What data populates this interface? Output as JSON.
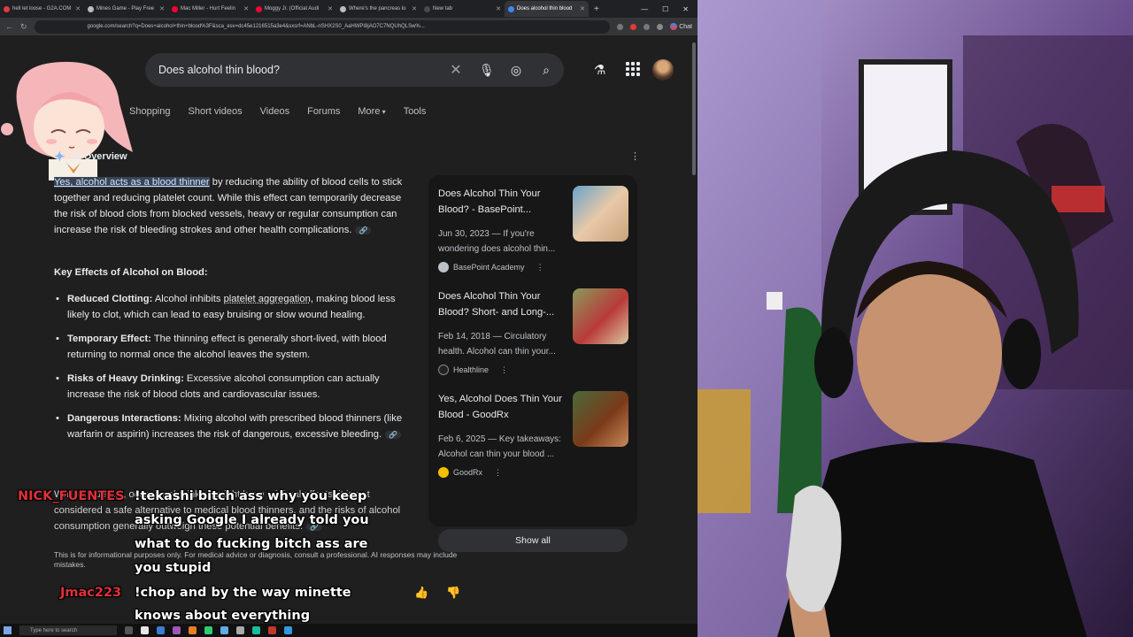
{
  "tabs": [
    {
      "label": "hell let loose - G2A.COM",
      "color": "#e03b3b"
    },
    {
      "label": "Mines Game - Play Free",
      "color": "#bbbbbb"
    },
    {
      "label": "Mac Miller - Hurt Feelin",
      "color": "#ff0033"
    },
    {
      "label": "Moggy Jr. (Official Audi",
      "color": "#ff0033"
    },
    {
      "label": "Where's the pancreas lo",
      "color": "#bbbbbb"
    },
    {
      "label": "New tab",
      "color": "#4a4a4a"
    },
    {
      "label": "Does alcohol thin blood",
      "color": "#4285f4",
      "active": true
    }
  ],
  "browser": {
    "url": "google.com/search?q=Does+alcohol+thin+blood%3F&sca_esv=dc45e1216515a3e4&sxsrf=ANbL-nSHX2S0_AaHWPI8jAO7C7NQUhQLSw%...",
    "chat_label": "Chat"
  },
  "search": {
    "query": "Does alcohol thin blood?",
    "tabs": [
      "Shopping",
      "Short videos",
      "Videos",
      "Forums",
      "More",
      "Tools"
    ]
  },
  "ai_overview": {
    "title": "AI Overview",
    "highlight": "Yes, alcohol acts as a blood thinner",
    "intro_rest": " by reducing the ability of blood cells to stick together and reducing platelet count. While this effect can temporarily decrease the risk of blood clots from blocked vessels, heavy or regular consumption can increase the risk of bleeding strokes and other health complications.",
    "key_heading": "Key Effects of Alcohol on Blood:",
    "bullets": [
      {
        "bold": "Reduced Clotting:",
        "pre": " Alcohol inhibits ",
        "link": "platelet aggregation",
        "post": ", making blood less likely to clot, which can lead to easy bruising or slow wound healing."
      },
      {
        "bold": "Temporary Effect:",
        "pre": " The thinning effect is generally short-lived, with blood returning to normal once the alcohol leaves the system.",
        "link": "",
        "post": ""
      },
      {
        "bold": "Risks of Heavy Drinking:",
        "pre": " Excessive alcohol consumption can actually increase the risk of blood clots and cardiovascular issues.",
        "link": "",
        "post": ""
      },
      {
        "bold": "Dangerous Interactions:",
        "pre": " Mixing alcohol with prescribed blood thinners (like warfarin or aspirin) increases the risk of dangerous, excessive bleeding.",
        "link": "",
        "post": ""
      }
    ],
    "closing": "While moderate, occasional drinking might have minimal effects, it is not considered a safe alternative to medical blood thinners, and the risks of alcohol consumption generally outweigh these potential benefits.",
    "disclaimer": "This is for informational purposes only. For medical advice or diagnosis, consult a professional. AI responses may include mistakes."
  },
  "sources": [
    {
      "title": "Does Alcohol Thin Your Blood? - BasePoint...",
      "desc": "Jun 30, 2023 — If you're wondering does alcohol thin...",
      "site": "BasePoint Academy",
      "color": "#c9a27a"
    },
    {
      "title": "Does Alcohol Thin Your Blood? Short- and Long-...",
      "desc": "Feb 14, 2018 — Circulatory health. Alcohol can thin your...",
      "site": "Healthline",
      "color": "#b83a3a"
    },
    {
      "title": "Yes, Alcohol Does Thin Your Blood - GoodRx",
      "desc": "Feb 6, 2025 — Key takeaways: Alcohol can thin your blood ...",
      "site": "GoodRx",
      "color": "#7a3a1a"
    }
  ],
  "show_all": "Show all",
  "chat": [
    {
      "user": "NICK_FUENTES",
      "lines": [
        "!tekashi bitch ass why you keep",
        "asking Google I already told you",
        "what to do fucking bitch ass are",
        "you stupid"
      ]
    },
    {
      "user": "Jmac223",
      "lines": [
        "!chop and by the way minette",
        "knows about everything"
      ]
    }
  ],
  "taskbar": {
    "search_placeholder": "Type here to search"
  }
}
